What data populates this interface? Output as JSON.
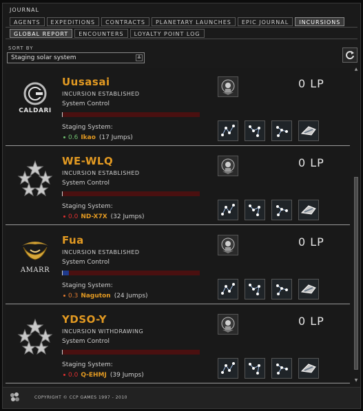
{
  "window": {
    "title": "JOURNAL",
    "main_tabs": [
      "AGENTS",
      "EXPEDITIONS",
      "CONTRACTS",
      "PLANETARY LAUNCHES",
      "EPIC JOURNAL",
      "INCURSIONS"
    ],
    "active_main_tab": "INCURSIONS",
    "sub_tabs": [
      "GLOBAL REPORT",
      "ENCOUNTERS",
      "LOYALTY POINT LOG"
    ],
    "active_sub_tab": "GLOBAL REPORT"
  },
  "sort": {
    "label": "SORT BY",
    "value": "Staging solar system",
    "dropdown_glyph": "≚",
    "refresh_icon": "refresh-icon"
  },
  "incursions": [
    {
      "faction": "Caldari",
      "logo_text": "CALDARI",
      "system": "Uusasai",
      "status": "INCURSION ESTABLISHED",
      "control_label": "System Control",
      "influence": 0.0,
      "staging_label": "Staging System:",
      "staging_security": "0.6",
      "staging_security_color": "#70c070",
      "staging_system": "Ikao",
      "jumps": "(17 Jumps)",
      "lp": "0 LP"
    },
    {
      "faction": "Unknown",
      "logo_text": "",
      "system": "WE-WLQ",
      "status": "INCURSION ESTABLISHED",
      "control_label": "System Control",
      "influence": 0.0,
      "staging_label": "Staging System:",
      "staging_security": "0.0",
      "staging_security_color": "#e03030",
      "staging_system": "ND-X7X",
      "jumps": "(32 Jumps)",
      "lp": "0 LP"
    },
    {
      "faction": "Amarr",
      "logo_text": "AMARR",
      "system": "Fua",
      "status": "INCURSION ESTABLISHED",
      "control_label": "System Control",
      "influence": 0.05,
      "staging_label": "Staging System:",
      "staging_security": "0.3",
      "staging_security_color": "#e07a30",
      "staging_system": "Naguton",
      "jumps": "(24 Jumps)",
      "lp": "0 LP"
    },
    {
      "faction": "Unknown",
      "logo_text": "",
      "system": "YDSO-Y",
      "status": "INCURSION WITHDRAWING",
      "control_label": "System Control",
      "influence": 0.0,
      "staging_label": "Staging System:",
      "staging_security": "0.0",
      "staging_security_color": "#e03030",
      "staging_system": "Q-EHMJ",
      "jumps": "(39 Jumps)",
      "lp": "0 LP"
    }
  ],
  "footer": {
    "copyright": "COPYRIGHT © CCP GAMES 1997 - 2010",
    "logo_text": "ccp"
  }
}
